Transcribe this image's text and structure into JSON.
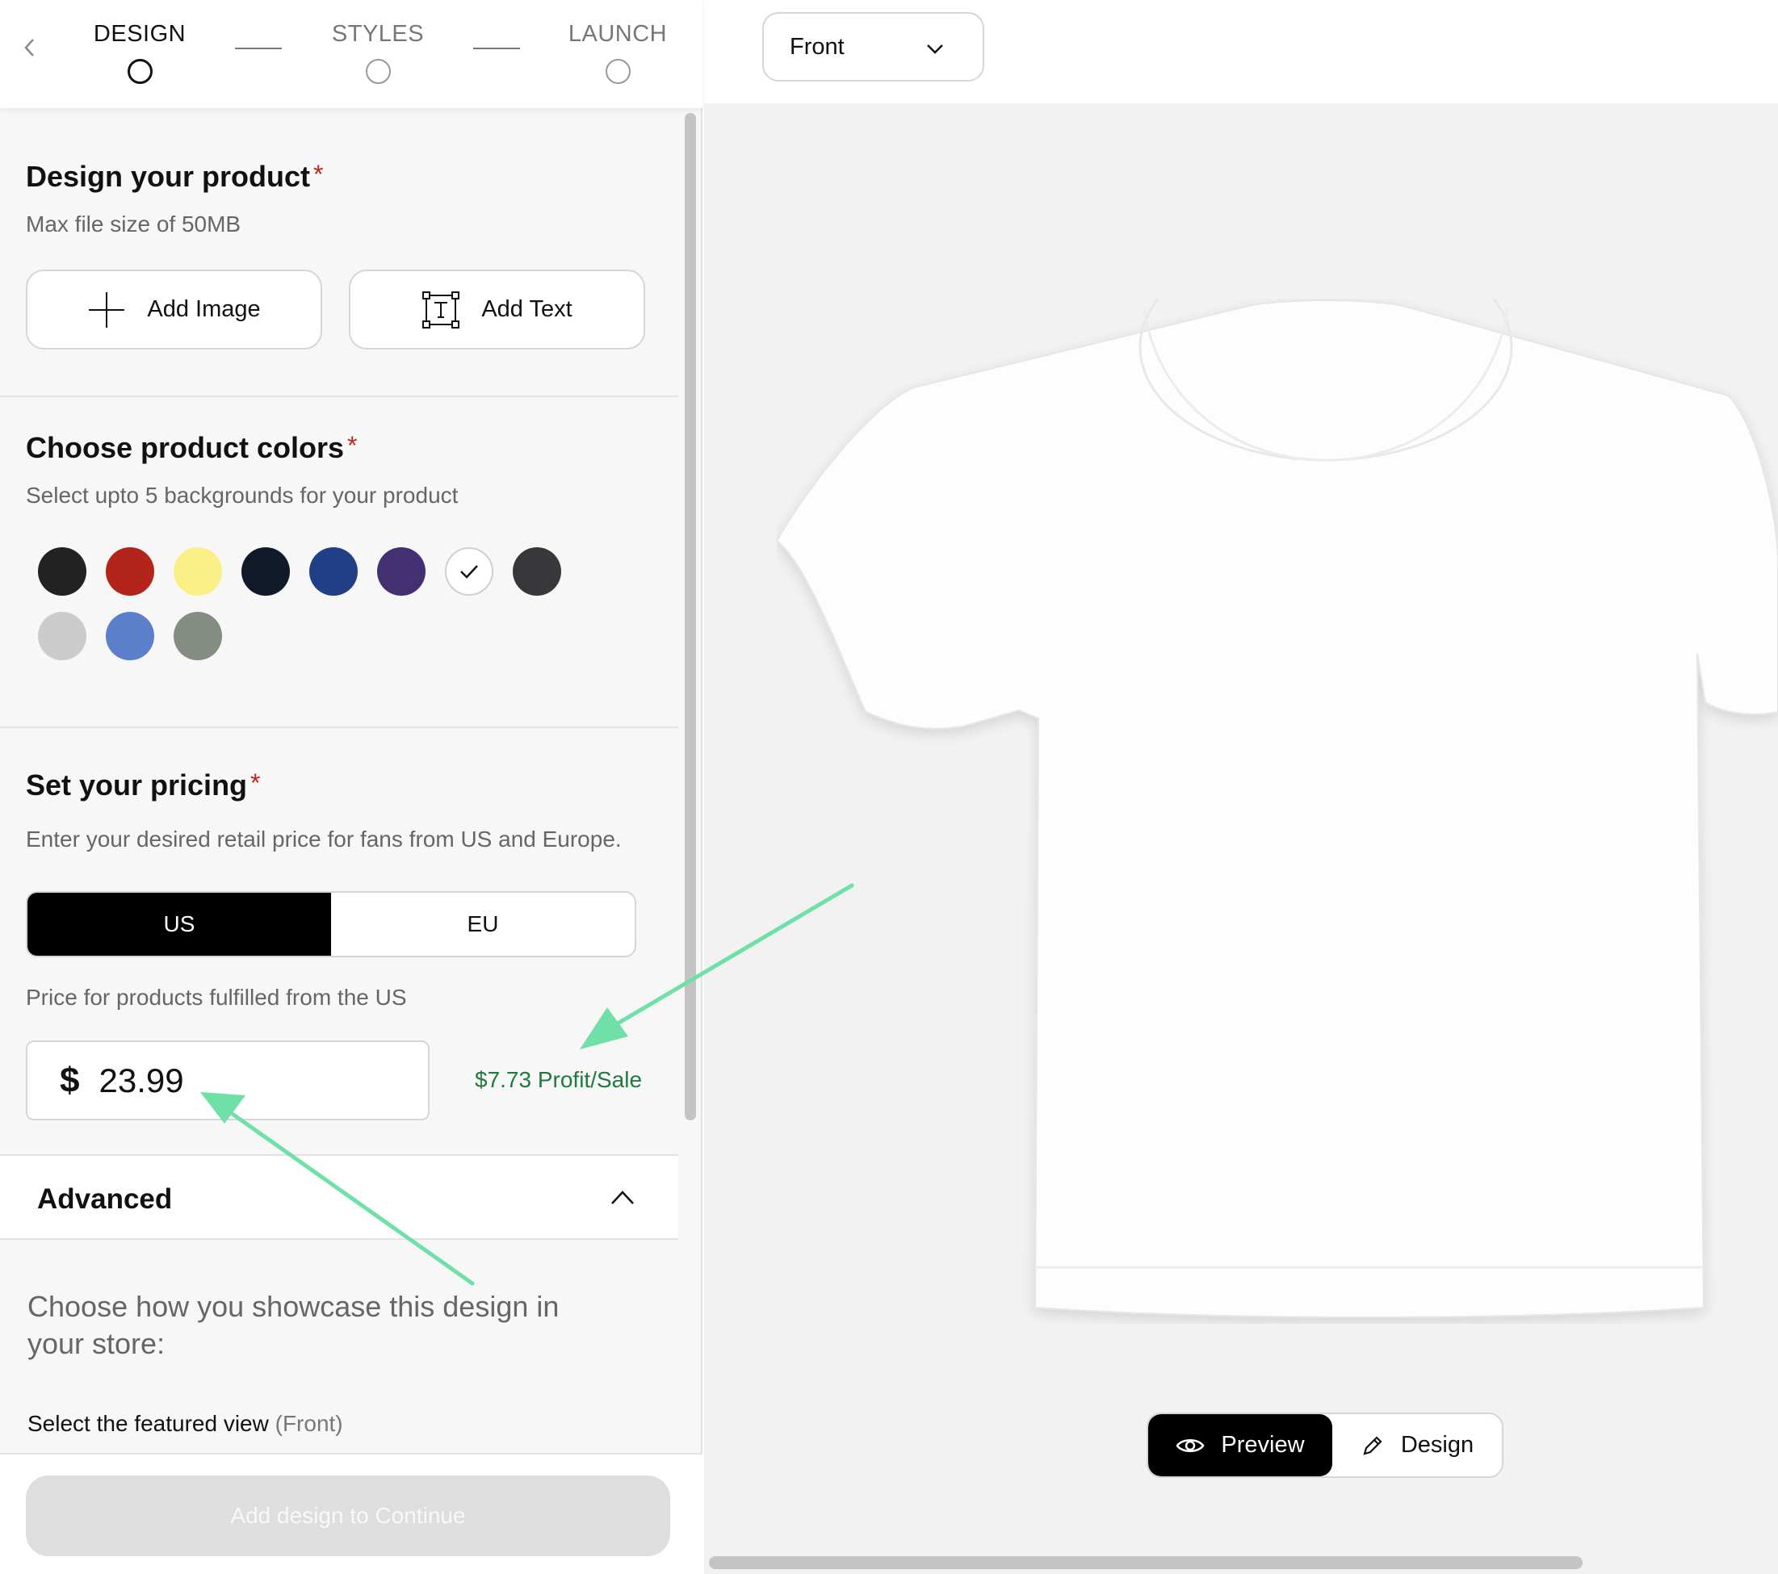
{
  "stepper": {
    "steps": [
      {
        "label": "DESIGN",
        "active": true
      },
      {
        "label": "STYLES",
        "active": false
      },
      {
        "label": "LAUNCH",
        "active": false
      }
    ]
  },
  "design_section": {
    "title": "Design your product",
    "required_mark": "*",
    "subtitle": "Max file size of 50MB",
    "add_image_label": "Add Image",
    "add_text_label": "Add Text"
  },
  "colors_section": {
    "title": "Choose product colors",
    "required_mark": "*",
    "subtitle": "Select upto 5 backgrounds for your product",
    "swatches": [
      {
        "name": "black",
        "color": "#222222",
        "selected": false
      },
      {
        "name": "red",
        "color": "#b3241b",
        "selected": false
      },
      {
        "name": "yellow",
        "color": "#fbef88",
        "selected": false
      },
      {
        "name": "navy-black",
        "color": "#111a29",
        "selected": false
      },
      {
        "name": "royal-blue",
        "color": "#203f86",
        "selected": false
      },
      {
        "name": "purple",
        "color": "#433072",
        "selected": false
      },
      {
        "name": "white",
        "color": "#ffffff",
        "selected": true
      },
      {
        "name": "charcoal",
        "color": "#38383a",
        "selected": false
      },
      {
        "name": "light-gray",
        "color": "#cccccc",
        "selected": false
      },
      {
        "name": "light-blue",
        "color": "#5b7fcb",
        "selected": false
      },
      {
        "name": "olive-gray",
        "color": "#858c82",
        "selected": false
      }
    ]
  },
  "pricing_section": {
    "title": "Set your pricing",
    "required_mark": "*",
    "subtitle": "Enter your desired retail price for fans from US and Europe.",
    "regions": [
      "US",
      "EU"
    ],
    "selected_region": "US",
    "fulfillment_note": "Price for products fulfilled from the US",
    "currency_symbol": "$",
    "price_value": "23.99",
    "profit_text": "$7.73 Profit/Sale",
    "profit_color": "#1f7a3d"
  },
  "advanced": {
    "title": "Advanced",
    "showcase_text": "Choose how you showcase this design in your store:",
    "featured_label": "Select the featured view",
    "featured_value": "(Front)"
  },
  "footer": {
    "continue_label": "Add design to Continue"
  },
  "canvas": {
    "view_select_value": "Front",
    "preview_label": "Preview",
    "design_label": "Design",
    "annotation_arrow_color": "#6ee0a8"
  }
}
